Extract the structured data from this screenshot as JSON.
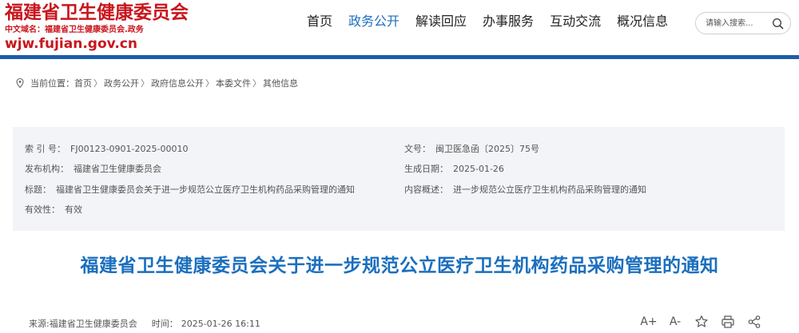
{
  "header": {
    "logo_title": "福建省卫生健康委员会",
    "logo_cn_domain": "中文域名：福建省卫生健康委员会.政务",
    "logo_url": "wjw.fujian.gov.cn"
  },
  "nav": {
    "items": [
      {
        "label": "首页"
      },
      {
        "label": "政务公开"
      },
      {
        "label": "解读回应"
      },
      {
        "label": "办事服务"
      },
      {
        "label": "互动交流"
      },
      {
        "label": "概况信息"
      }
    ],
    "active_index": 1
  },
  "search": {
    "placeholder": "请输入搜索..."
  },
  "breadcrumb": {
    "prefix": "当前位置：",
    "items": [
      "首页",
      "政务公开",
      "政府信息公开",
      "本委文件",
      "其他信息"
    ],
    "separator": "〉"
  },
  "meta": {
    "index_label": "索 引 号：",
    "index_value": "FJ00123-0901-2025-00010",
    "doc_no_label": "文号：",
    "doc_no_value": "闽卫医急函〔2025〕75号",
    "publisher_label": "发布机构：",
    "publisher_value": "福建省卫生健康委员会",
    "date_label": "生成日期：",
    "date_value": "2025-01-26",
    "title_label": "标题：",
    "title_value": "福建省卫生健康委员会关于进一步规范公立医疗卫生机构药品采购管理的通知",
    "summary_label": "内容概述：",
    "summary_value": "进一步规范公立医疗卫生机构药品采购管理的通知",
    "validity_label": "有效性：",
    "validity_value": "有效"
  },
  "document": {
    "title": "福建省卫生健康委员会关于进一步规范公立医疗卫生机构药品采购管理的通知",
    "source": "来源:福建省卫生健康委员会",
    "time_label": "时间：",
    "time_value": "2025-01-26 16:11"
  },
  "tools": {
    "font_larger": "A+",
    "font_smaller": "A-"
  },
  "colors": {
    "brand_red": "#c8161d",
    "accent_blue": "#1b6fbe",
    "bar_blue": "#1b5ea8",
    "meta_bg": "#f2f4f7"
  }
}
